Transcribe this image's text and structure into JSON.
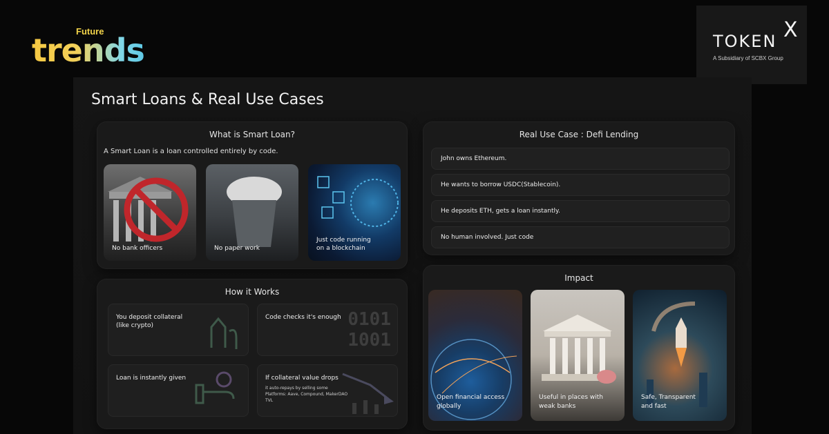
{
  "brand_left": {
    "small": "Future",
    "large": "trends"
  },
  "brand_right": {
    "name": "TOKEN",
    "mark": "X",
    "subtitle": "A Subsidiary of SCBX Group"
  },
  "slide": {
    "title": "Smart Loans & Real Use Cases",
    "smart_loan": {
      "title": "What is Smart Loan?",
      "description": "A Smart Loan is a loan controlled entirely by code.",
      "cards": [
        {
          "caption": "No bank officers"
        },
        {
          "caption": "No paper work"
        },
        {
          "caption": "Just code running\non a blockchain"
        }
      ]
    },
    "use_case": {
      "title": "Real Use Case : Defi Lending",
      "rows": [
        "John owns Ethereum.",
        "He wants to borrow USDC(Stablecoin).",
        "He deposits ETH, gets a loan instantly.",
        "No human involved. Just code"
      ]
    },
    "how_it_works": {
      "title": "How it Works",
      "steps": [
        {
          "text": "You deposit collateral\n(like crypto)"
        },
        {
          "text": "Code checks it's enough",
          "decor": "0101\n1001"
        },
        {
          "text": "Loan is instantly given"
        },
        {
          "text": "If collateral value drops",
          "detail": "it auto-repays by selling some\nPlatforms: Aave, Compound, MakerDAO\nTVL"
        }
      ]
    },
    "impact": {
      "title": "Impact",
      "cards": [
        {
          "caption": "Open financial access\nglobally"
        },
        {
          "caption": "Useful in places with\nweak banks"
        },
        {
          "caption": "Safe, Transparent\nand fast"
        }
      ]
    }
  }
}
